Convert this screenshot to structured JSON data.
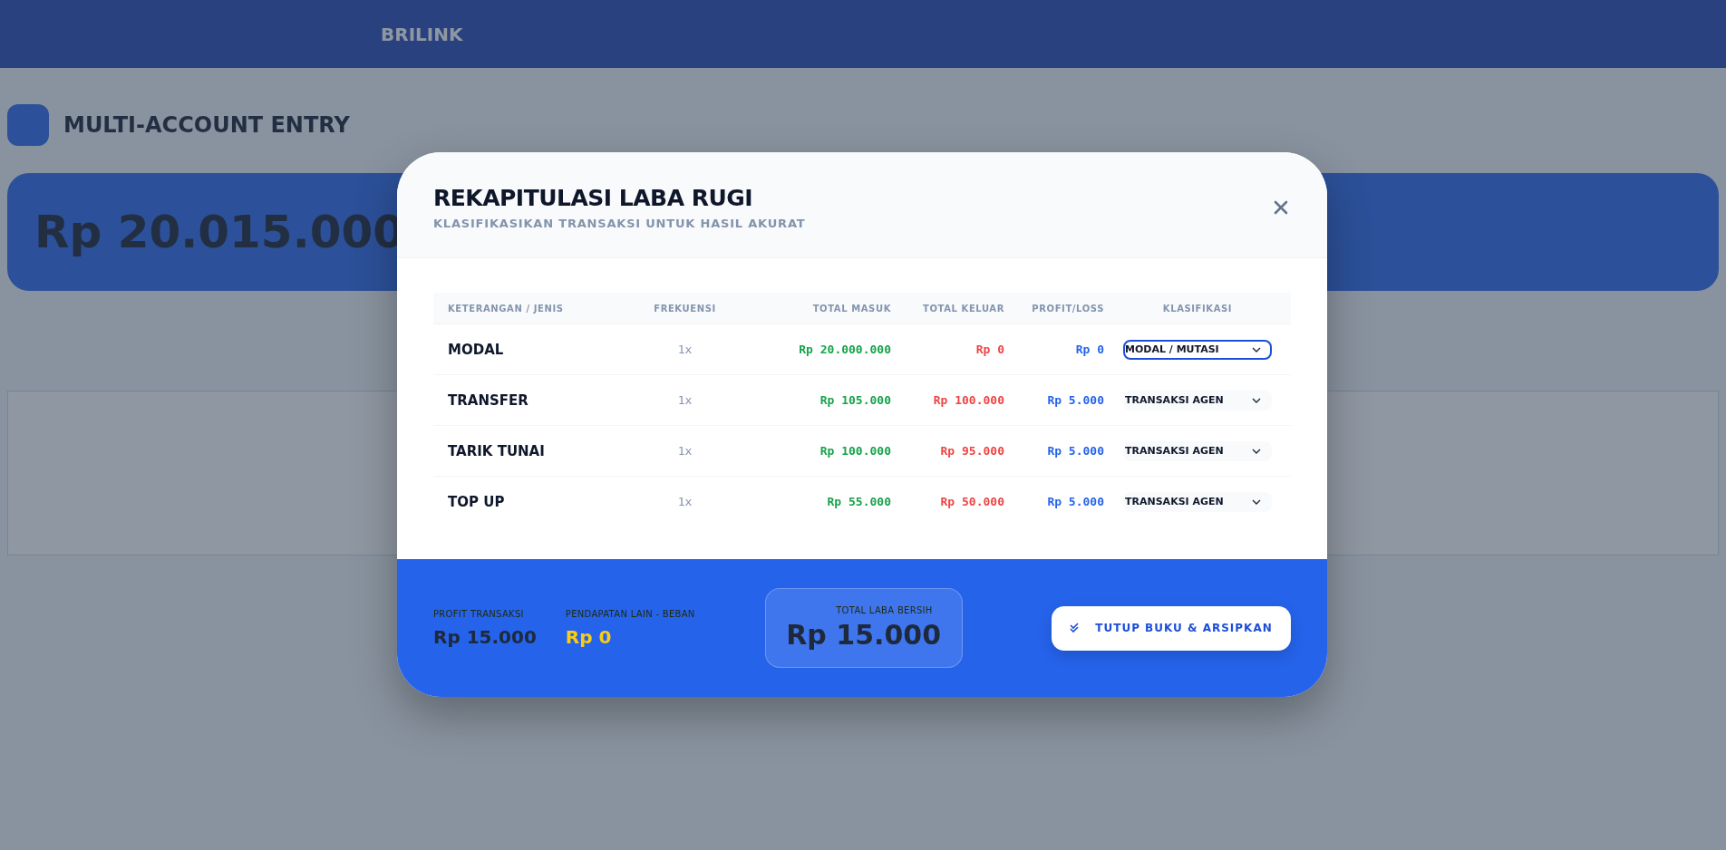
{
  "background": {
    "brand": "BRILINK",
    "page_title": "MULTI-ACCOUNT ENTRY",
    "balance": "Rp 20.015.000"
  },
  "modal": {
    "title": "REKAPITULASI LABA RUGI",
    "subtitle": "KLASIFIKASIKAN TRANSAKSI UNTUK HASIL AKURAT",
    "table": {
      "columns": [
        "KETERANGAN / JENIS",
        "FREKUENSI",
        "TOTAL MASUK",
        "TOTAL KELUAR",
        "PROFIT/LOSS",
        "KLASIFIKASI"
      ],
      "rows": [
        {
          "jenis": "MODAL",
          "frekuensi": "1x",
          "masuk": "Rp 20.000.000",
          "keluar": "Rp 0",
          "profit": "Rp 0",
          "klasifikasi": "MODAL / MUTASI",
          "focused": true
        },
        {
          "jenis": "TRANSFER",
          "frekuensi": "1x",
          "masuk": "Rp 105.000",
          "keluar": "Rp 100.000",
          "profit": "Rp 5.000",
          "klasifikasi": "TRANSAKSI AGEN",
          "focused": false
        },
        {
          "jenis": "TARIK TUNAI",
          "frekuensi": "1x",
          "masuk": "Rp 100.000",
          "keluar": "Rp 95.000",
          "profit": "Rp 5.000",
          "klasifikasi": "TRANSAKSI AGEN",
          "focused": false
        },
        {
          "jenis": "TOP UP",
          "frekuensi": "1x",
          "masuk": "Rp 55.000",
          "keluar": "Rp 50.000",
          "profit": "Rp 5.000",
          "klasifikasi": "TRANSAKSI AGEN",
          "focused": false
        }
      ]
    },
    "footer": {
      "profit_label": "PROFIT TRANSAKSI",
      "profit_value": "Rp 15.000",
      "other_label": "PENDAPATAN LAIN - BEBAN",
      "other_value": "Rp 0",
      "total_label": "TOTAL LABA BERSIH",
      "total_value": "Rp 15.000",
      "button": "TUTUP BUKU & ARSIPKAN"
    }
  }
}
